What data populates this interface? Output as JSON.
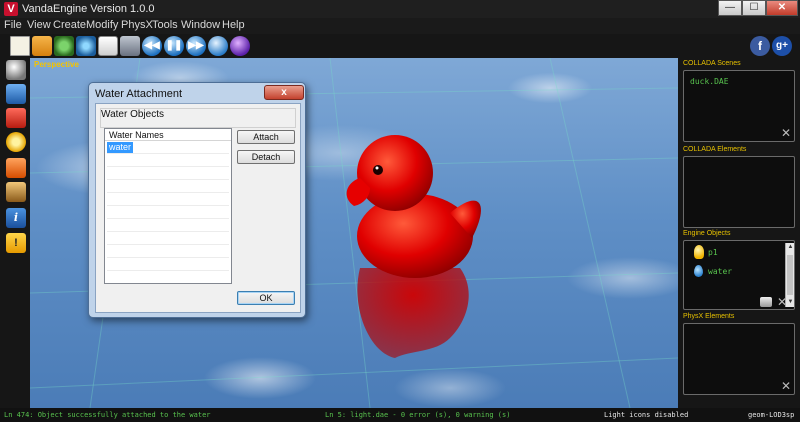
{
  "window": {
    "title": "VandaEngine Version 1.0.0",
    "app_icon": "V"
  },
  "window_controls": {
    "min": "—",
    "max": "☐",
    "close": "✕"
  },
  "menu": [
    "File",
    "View",
    "Create",
    "Modify",
    "PhysX",
    "Tools",
    "Window",
    "Help"
  ],
  "toolbar": {
    "icons": [
      "new-document-icon",
      "open-folder-icon",
      "gear-settings-icon",
      "molecule-icon",
      "save-icon",
      "camera-icon",
      "rewind-icon",
      "pause-icon",
      "forward-icon",
      "info-circle-icon",
      "orb-icon",
      "facebook-icon",
      "google-plus-icon"
    ],
    "rewind": "◀◀",
    "pause": "❚❚",
    "forward": "▶▶",
    "facebook": "f",
    "gplus": "g+"
  },
  "left_tools": {
    "icons": [
      "sphere-icon",
      "network-icon",
      "red-tool-icon",
      "sun-light-icon",
      "sound-icon",
      "camera-icon",
      "info-icon",
      "warning-icon"
    ],
    "info": "i",
    "warning": "!"
  },
  "viewport": {
    "label": "Perspective"
  },
  "dialog": {
    "title": "Water Attachment",
    "close": "x",
    "group_label": "Water Objects",
    "list_header": "Water Names",
    "items": [
      "water"
    ],
    "attach_label": "Attach",
    "detach_label": "Detach",
    "ok_label": "OK"
  },
  "right_panel": {
    "collada_scenes": {
      "title": "COLLADA Scenes",
      "items": [
        "duck.DAE"
      ]
    },
    "collada_elements": {
      "title": "COLLADA Elements"
    },
    "engine_objects": {
      "title": "Engine Objects",
      "items": [
        "p1",
        "water"
      ]
    },
    "physx_elements": {
      "title": "PhysX Elements"
    },
    "delete_glyph": "✕"
  },
  "status": {
    "left": "Ln 474: Object successfully attached to the water",
    "center": "Ln 5: light.dae - 0 error (s), 0 warning (s)",
    "lights": "Light icons disabled",
    "right": "geom-LOD3sp"
  },
  "colors": {
    "panel_text": "#58c24e",
    "panel_title": "#e8c200",
    "duck": "#e00000",
    "selection": "#3399ff"
  }
}
